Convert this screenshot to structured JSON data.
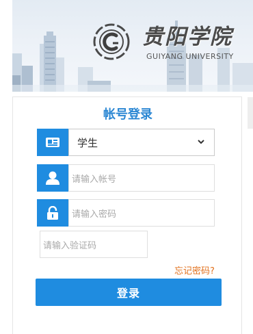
{
  "banner": {
    "logo_text_cn": "贵阳学院",
    "logo_text_en": "GUIYANG UNIVERSITY"
  },
  "login": {
    "title": "帐号登录",
    "user_type": {
      "selected": "学生",
      "options": [
        "学生"
      ]
    },
    "account_placeholder": "请输入帐号",
    "password_placeholder": "请输入密码",
    "captcha_placeholder": "请输入验证码",
    "forgot_password": "忘记密码?",
    "submit_label": "登录"
  },
  "colors": {
    "accent": "#1f8ce0",
    "title": "#2b87d3",
    "link": "#e2711d"
  },
  "icons": {
    "user_type": "id-card-icon",
    "account": "user-icon",
    "password": "lock-icon",
    "dropdown": "chevron-down-icon"
  }
}
